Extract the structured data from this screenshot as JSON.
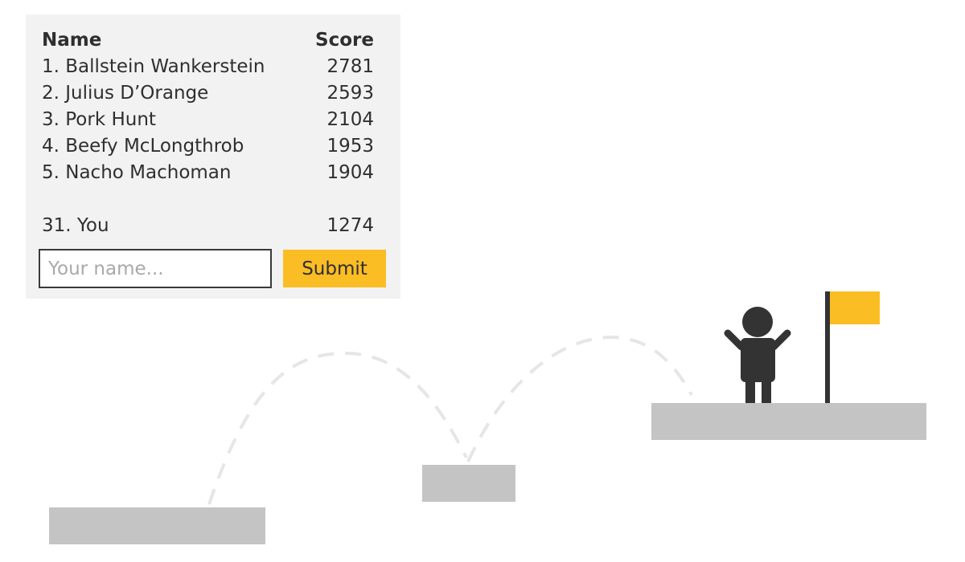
{
  "leaderboard": {
    "header": {
      "name": "Name",
      "score": "Score"
    },
    "entries": [
      {
        "name": "1. Ballstein Wankerstein",
        "score": "2781"
      },
      {
        "name": "2. Julius D’Orange",
        "score": "2593"
      },
      {
        "name": "3. Pork Hunt",
        "score": "2104"
      },
      {
        "name": "4. Beefy McLongthrob",
        "score": "1953"
      },
      {
        "name": "5. Nacho Machoman",
        "score": "1904"
      }
    ],
    "player": {
      "name": "31. You",
      "score": "1274"
    },
    "input": {
      "placeholder": "Your name...",
      "value": ""
    },
    "submit_label": "Submit"
  },
  "scene": {
    "icons": [
      "player-character-icon",
      "goal-flag-icon"
    ],
    "colors": {
      "platform": "#c4c4c4",
      "trajectory": "#e6e6e6",
      "character": "#333333",
      "flag": "#fbbd24",
      "panel": "#f2f2f2"
    }
  }
}
